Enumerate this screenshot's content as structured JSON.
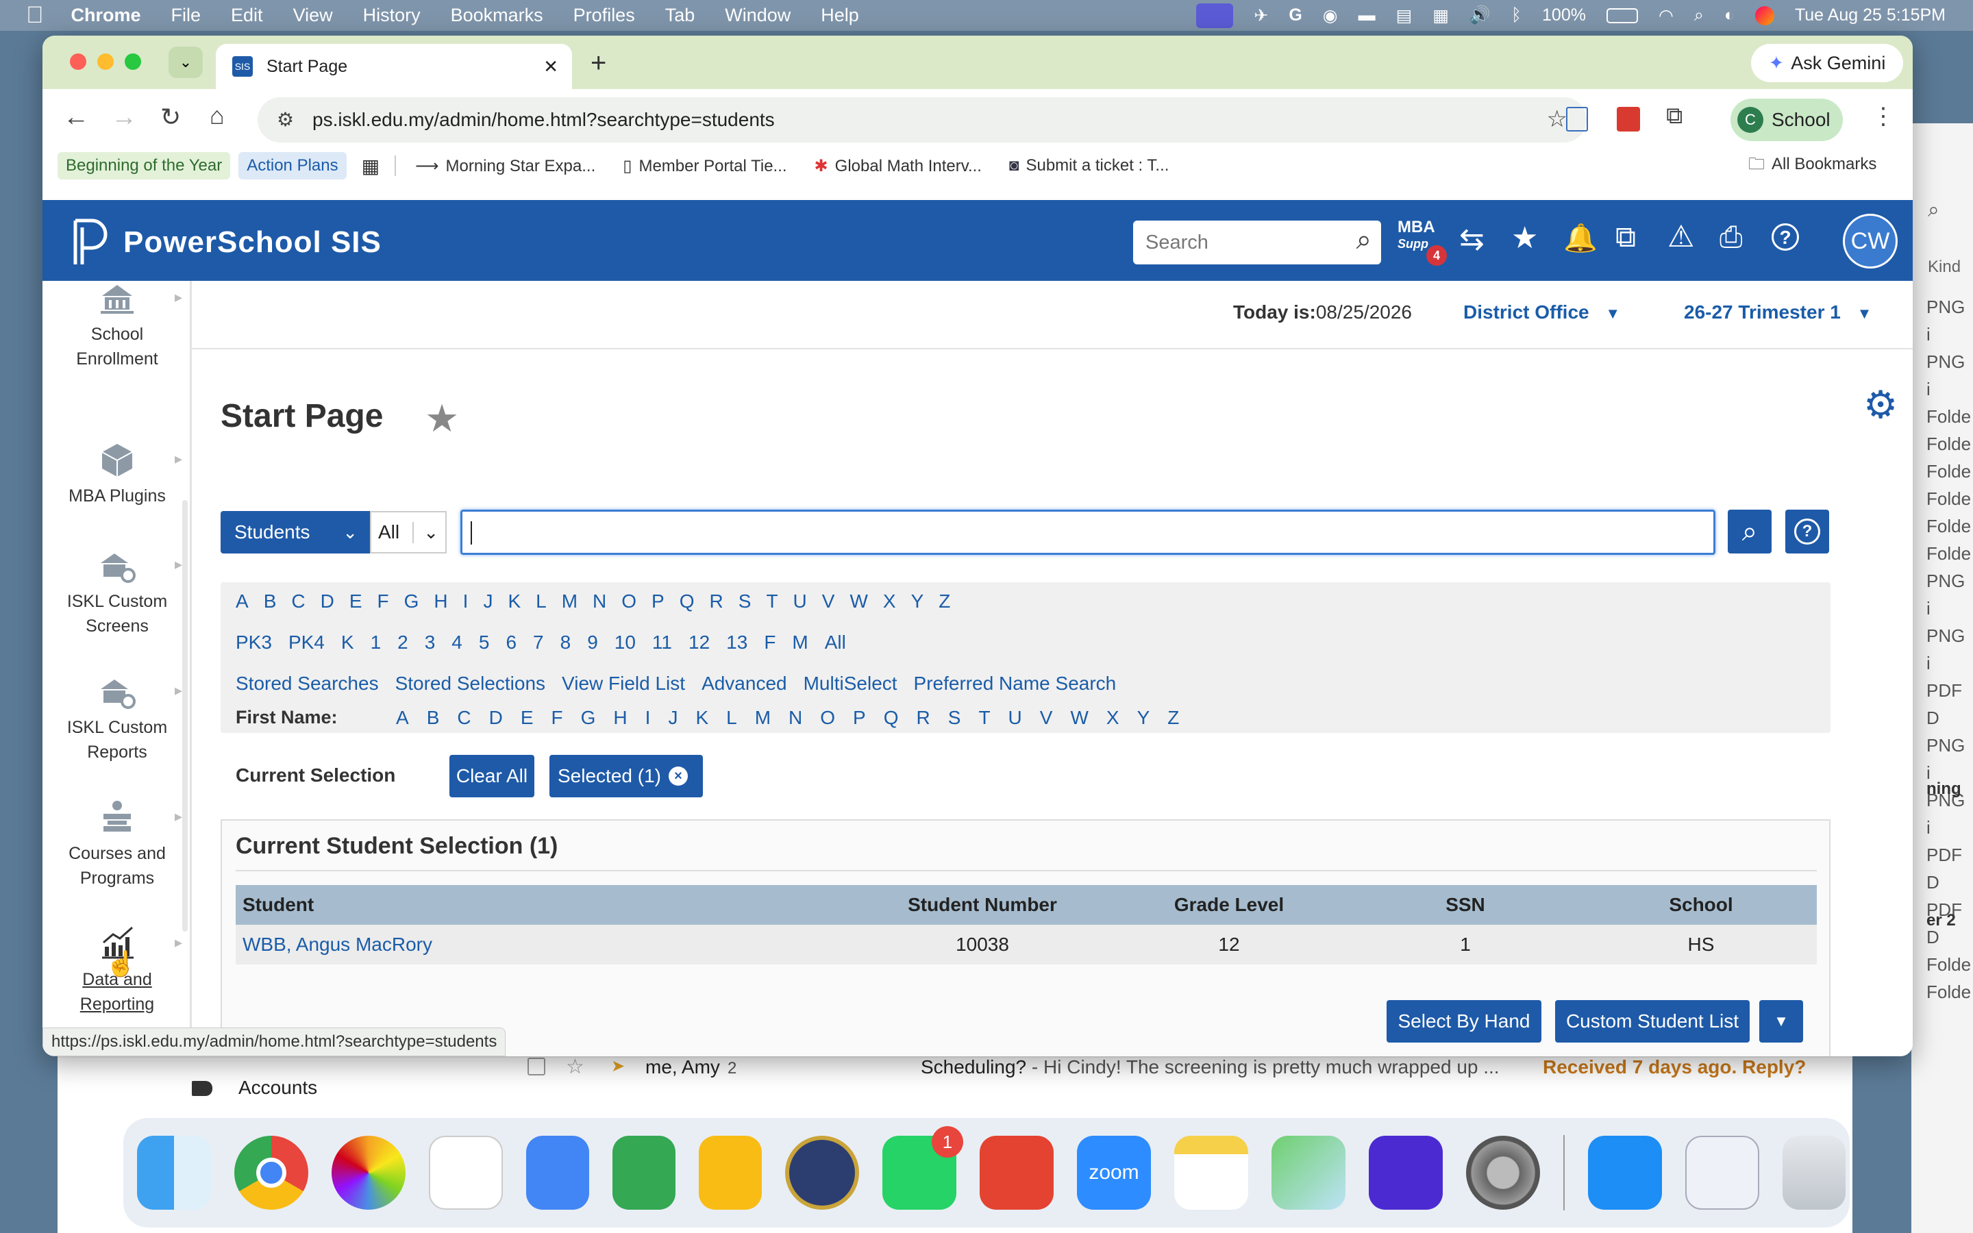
{
  "menubar": {
    "app": "Chrome",
    "items": [
      "File",
      "Edit",
      "View",
      "History",
      "Bookmarks",
      "Profiles",
      "Tab",
      "Window",
      "Help"
    ],
    "battery": "100%",
    "datetime": "Tue Aug 25  5:15PM"
  },
  "browser": {
    "tab_title": "Start Page",
    "ask_gemini": "Ask Gemini",
    "url": "ps.iskl.edu.my/admin/home.html?searchtype=students",
    "profile_initial": "C",
    "profile_label": "School",
    "bookmarks": [
      "Beginning of the Year",
      "Action Plans",
      "Morning Star Expa...",
      "Member Portal Tie...",
      "Global Math Interv...",
      "Submit a ticket : T..."
    ],
    "all_bookmarks": "All Bookmarks",
    "status_url": "https://ps.iskl.edu.my/admin/home.html?searchtype=students"
  },
  "ps": {
    "brand": "PowerSchool SIS",
    "search_placeholder": "Search",
    "mba_label": "MBA",
    "mba_sub": "Supp",
    "mba_badge": "4",
    "user_initials": "CW",
    "today_label": "Today is:",
    "today_date": "08/25/2026",
    "district": "District Office",
    "term": "26-27 Trimester 1",
    "sidebar": [
      {
        "label1": "School",
        "label2": "Enrollment"
      },
      {
        "label1": "MBA Plugins",
        "label2": ""
      },
      {
        "label1": "ISKL Custom",
        "label2": "Screens"
      },
      {
        "label1": "ISKL Custom",
        "label2": "Reports"
      },
      {
        "label1": "Courses and",
        "label2": "Programs"
      },
      {
        "label1": "Data and",
        "label2": "Reporting"
      }
    ],
    "page_title": "Start Page",
    "search_type": "Students",
    "search_scope": "All",
    "letters": [
      "A",
      "B",
      "C",
      "D",
      "E",
      "F",
      "G",
      "H",
      "I",
      "J",
      "K",
      "L",
      "M",
      "N",
      "O",
      "P",
      "Q",
      "R",
      "S",
      "T",
      "U",
      "V",
      "W",
      "X",
      "Y",
      "Z"
    ],
    "grades": [
      "PK3",
      "PK4",
      "K",
      "1",
      "2",
      "3",
      "4",
      "5",
      "6",
      "7",
      "8",
      "9",
      "10",
      "11",
      "12",
      "13",
      "F",
      "M",
      "All"
    ],
    "search_links": [
      "Stored Searches",
      "Stored Selections",
      "View Field List",
      "Advanced",
      "MultiSelect",
      "Preferred Name Search"
    ],
    "first_name_label": "First Name:",
    "current_selection_label": "Current Selection",
    "clear_all": "Clear All",
    "selected_badge": "Selected (1)",
    "selection_heading": "Current Student Selection (1)",
    "table": {
      "headers": [
        "Student",
        "Student Number",
        "Grade Level",
        "SSN",
        "School"
      ],
      "rows": [
        [
          "WBB, Angus MacRory",
          "10038",
          "12",
          "1",
          "HS"
        ]
      ]
    },
    "select_by_hand": "Select By Hand",
    "custom_student_list": "Custom Student List"
  },
  "background": {
    "accounts": "Accounts",
    "mail_sender": "me, Amy",
    "mail_count": "2",
    "mail_subject": "Scheduling?",
    "mail_snippet": " - Hi Cindy! The screening is pretty much wrapped up ...",
    "mail_status": "Received 7 days ago. Reply?",
    "right_items": [
      "PNG i",
      "PNG i",
      "Folde",
      "Folde",
      "Folde",
      "Folde",
      "Folde",
      "Folde",
      "PNG i",
      "PNG i",
      "PDF D",
      "PNG i",
      "PNG i",
      "PDF D",
      "PDF D",
      "Folde",
      "Folde"
    ],
    "right_kind": "Kind",
    "right_ing": "ning",
    "right_er2": "er 2"
  },
  "dock": {
    "whatsapp_badge": "1"
  }
}
